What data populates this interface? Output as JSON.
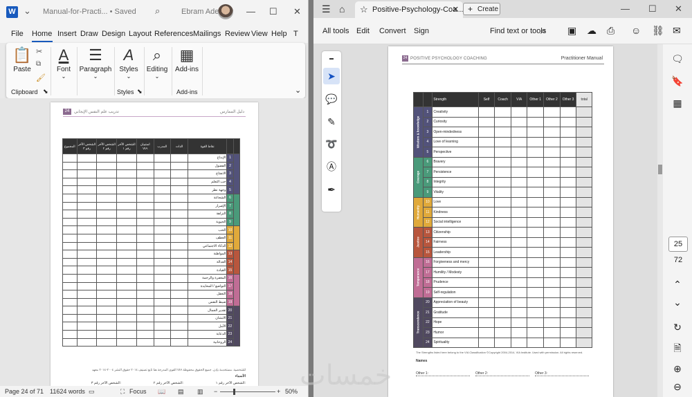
{
  "word": {
    "title": {
      "doc_name": "Manual-for-Practi... • Saved",
      "user": "Ebram Adel"
    },
    "menu": [
      "File",
      "Home",
      "Insert",
      "Draw",
      "Design",
      "Layout",
      "References",
      "Mailings",
      "Review",
      "View",
      "Help",
      "T"
    ],
    "ribbon": {
      "paste": "Paste",
      "clipboard": "Clipboard",
      "font": "Font",
      "paragraph": "Paragraph",
      "styles": "Styles",
      "styles_group": "Styles",
      "editing": "Editing",
      "addins": "Add-ins",
      "addins_group": "Add-ins"
    },
    "page": {
      "number": "24",
      "header_left": "تدريب علم النفس الإيجابي",
      "header_right": "دليل الممارس",
      "col_headers": [
        "المجموع",
        "الشخص الآخر رقم ٣",
        "الشخص الآخر رقم ٢",
        "الشخص الآخر رقم ١",
        "استبيان VIA",
        "المدرب",
        "الذات",
        "نقاط القوة"
      ],
      "rows": [
        "الإبداع",
        "الفضول",
        "الانفتاح",
        "حب التعلم",
        "وجهة نظر",
        "الشجاعة",
        "الإصرار",
        "النزاهة",
        "الحيوية",
        "الحب",
        "العطف",
        "الذكاء الاجتماعي",
        "المواطنة",
        "العدالة",
        "القيادة",
        "المغفرة والرحمة",
        "التواضع / المحايدة",
        "التعقل",
        "ضبط النفس",
        "تقدير الجمال",
        "الامتنان",
        "الأمل",
        "الدعابة",
        "الروحانية"
      ],
      "footnote": "القوى المدرجة هنا تابع تصنيف ٢٠١٤ حقوق النشر ٢٠٠٤-٢٠١٤ معهد VIA للشخصية. مستخدمة بإذن. جميع الحقوق محفوظة",
      "names": "الأسماء",
      "others": [
        "الشخص الآخر رقم ١:",
        "الشخص الآخر رقم ٢:",
        "الشخص الآخر رقم ٣:"
      ]
    },
    "status": {
      "page": "Page 24 of 71",
      "words": "11624 words",
      "focus": "Focus",
      "zoom": "50%"
    }
  },
  "pdf": {
    "tab_title": "Positive-Psychology-Coa...",
    "create": "Create",
    "toolbar": {
      "all_tools": "All tools",
      "edit": "Edit",
      "convert": "Convert",
      "sign": "Sign",
      "find": "Find text or tools"
    },
    "page": {
      "number": "24",
      "header_left": "POSITIVE PSYCHOLOGY COACHING",
      "header_right": "Practitioner Manual",
      "col_headers": [
        "Strength",
        "Self",
        "Coach",
        "VIA",
        "Other 1",
        "Other 2",
        "Other 3",
        "total"
      ],
      "strengths": [
        "Creativity",
        "Curiosity",
        "Open-mindedness",
        "Love of learning",
        "Perspective",
        "Bravery",
        "Persistence",
        "Integrity",
        "Vitality",
        "Love",
        "Kindness",
        "Social intelligence",
        "Citizenship",
        "Fairness",
        "Leadership",
        "Forgiveness and mercy",
        "Humility / Modesty",
        "Prudence",
        "Self-regulation",
        "Appreciation of beauty",
        "Gratitude",
        "Hope",
        "Humor",
        "Spirituality"
      ],
      "virtues": [
        {
          "name": "Wisdom & knowledge",
          "rows": 5,
          "color": "#52527a"
        },
        {
          "name": "Courage",
          "rows": 4,
          "color": "#4a9a7a"
        },
        {
          "name": "Humanity",
          "rows": 3,
          "color": "#e0a93a"
        },
        {
          "name": "Justice",
          "rows": 3,
          "color": "#b8563d"
        },
        {
          "name": "Temperance",
          "rows": 4,
          "color": "#c06d95"
        },
        {
          "name": "Transcendence",
          "rows": 5,
          "color": "#504960"
        }
      ],
      "footnote": "The Strengths listed here belong to the VIA Classification ©Copyright 2004-2014, VIA Institute. Used with permission. All rights reserved.",
      "names": "Names",
      "others": [
        "Other 1:",
        "Other 2:",
        "Other 3:"
      ]
    },
    "nav": {
      "current_page": "25",
      "total_pages": "72"
    }
  }
}
